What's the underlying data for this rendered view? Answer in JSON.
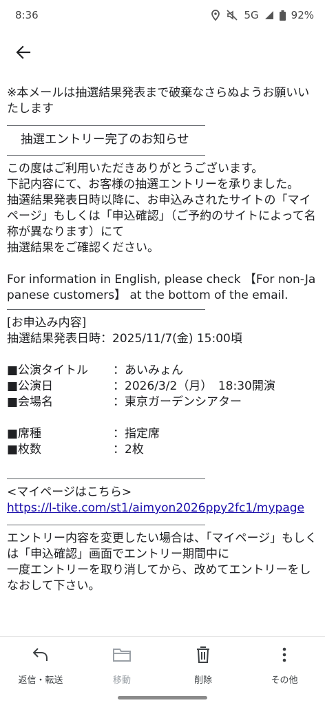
{
  "status_bar": {
    "time": "8:36",
    "network": "5G",
    "battery": "92%",
    "icons": [
      "location-icon",
      "mute-icon",
      "signal-icon",
      "battery-icon"
    ]
  },
  "header": {
    "back_icon": "arrow-left-icon"
  },
  "mail": {
    "notice": "※本メールは抽選結果発表まで破棄なさらぬようお願いいたします",
    "heading": "抽選エントリー完了のお知らせ",
    "intro": "この度はご利用いただきありがとうございます。\n下記内容にて、お客様の抽選エントリーを承りました。\n抽選結果発表日時以降に、お申込みされたサイトの「マイページ」もしくは「申込確認」（ご予約のサイトによって名称が異なります）にて\n抽選結果をご確認ください。",
    "english_note": "For information in English, please check 【For non-Japanese customers】 at the bottom of the email.",
    "details_title": "[お申込み内容]",
    "result_datetime": "抽選結果発表日時：2025/11/7(金) 15:00頃",
    "performance": [
      {
        "label": "■公演タイトル",
        "value": "：あいみょん"
      },
      {
        "label": "■公演日",
        "value": "：2026/3/2（月）　18:30開演"
      },
      {
        "label": "■会場名",
        "value": "：東京ガーデンシアター"
      }
    ],
    "tickets": [
      {
        "label": "■席種",
        "value": "：指定席"
      },
      {
        "label": "■枚数",
        "value": "：2枚"
      }
    ],
    "mypage_label": "<マイページはこちら>",
    "mypage_url": "https://l-tike.com/st1/aimyon2026ppy2fc1/mypage",
    "change_note": "エントリー内容を変更したい場合は、「マイページ」もしくは「申込確認」画面でエントリー期間中に\n一度エントリーを取り消してから、改めてエントリーをしなおして下さい。"
  },
  "bottom_actions": [
    {
      "label": "返信・転送",
      "icon": "reply-icon",
      "enabled": true
    },
    {
      "label": "移動",
      "icon": "folder-icon",
      "enabled": false
    },
    {
      "label": "削除",
      "icon": "trash-icon",
      "enabled": true
    },
    {
      "label": "その他",
      "icon": "more-vert-icon",
      "enabled": true
    }
  ]
}
